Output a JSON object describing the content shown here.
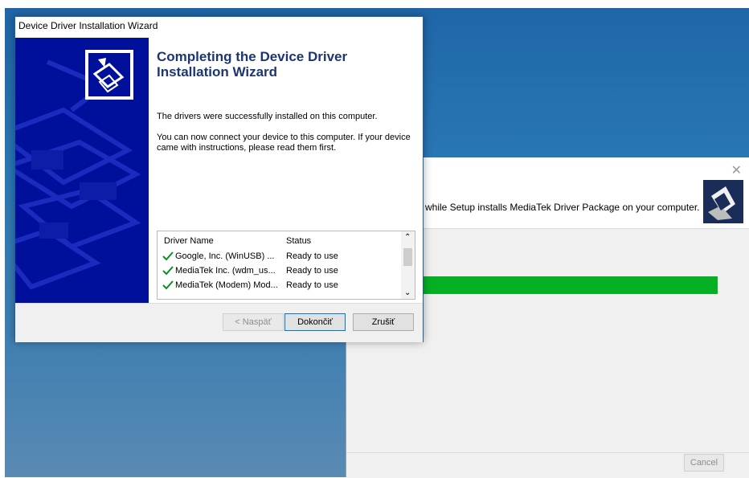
{
  "wizard": {
    "title": "Device Driver Installation Wizard",
    "heading": "Completing the Device Driver Installation Wizard",
    "paragraph1": "The drivers were successfully installed on this computer.",
    "paragraph2": "You can now connect your device to this computer. If your device came with instructions, please read them first.",
    "list": {
      "columns": [
        "Driver Name",
        "Status"
      ],
      "rows": [
        {
          "name": "Google, Inc. (WinUSB) ...",
          "status": "Ready to use"
        },
        {
          "name": "MediaTek Inc. (wdm_us...",
          "status": "Ready to use"
        },
        {
          "name": "MediaTek (Modem) Mod...",
          "status": "Ready to use"
        }
      ]
    },
    "buttons": {
      "back": "< Naspäť",
      "finish": "Dokončiť",
      "cancel": "Zrušiť"
    }
  },
  "setup": {
    "message": "while Setup installs MediaTek Driver Package on your computer.",
    "progress": 1.0,
    "cancel": "Cancel",
    "close_icon": "close-icon"
  },
  "colors": {
    "wizard_side": "#00109a",
    "heading": "#1d3571",
    "progress": "#06b025"
  }
}
